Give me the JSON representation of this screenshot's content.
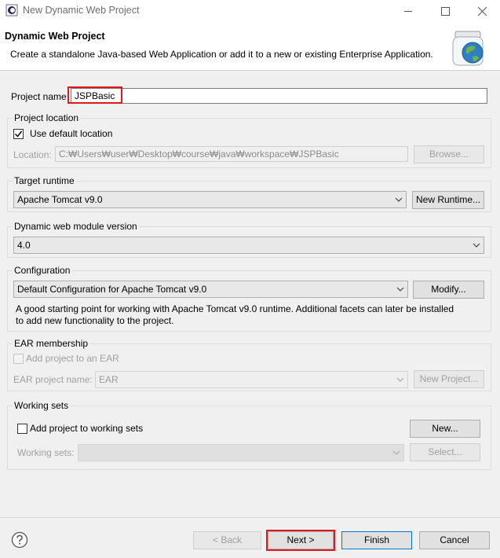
{
  "window": {
    "title": "New Dynamic Web Project"
  },
  "banner": {
    "title": "Dynamic Web Project",
    "description": "Create a standalone Java-based Web Application or add it to a new or existing Enterprise Application."
  },
  "project_name": {
    "label": "Project name:",
    "value": "JSPBasic"
  },
  "project_location": {
    "group_label": "Project location",
    "use_default_label": "Use default location",
    "use_default_checked": true,
    "location_label": "Location:",
    "location_value": "C:₩Users₩user₩Desktop₩course₩java₩workspace₩JSPBasic",
    "browse_label": "Browse..."
  },
  "target_runtime": {
    "group_label": "Target runtime",
    "selected": "Apache Tomcat v9.0",
    "new_runtime_label": "New Runtime..."
  },
  "module_version": {
    "group_label": "Dynamic web module version",
    "selected": "4.0"
  },
  "configuration": {
    "group_label": "Configuration",
    "selected": "Default Configuration for Apache Tomcat v9.0",
    "modify_label": "Modify...",
    "description_line1": "A good starting point for working with Apache Tomcat v9.0 runtime. Additional facets can later be installed",
    "description_line2": "to add new functionality to the project."
  },
  "ear_membership": {
    "group_label": "EAR membership",
    "add_label": "Add project to an EAR",
    "add_checked": false,
    "ear_name_label": "EAR project name:",
    "ear_name_value": "EAR",
    "new_project_label": "New Project..."
  },
  "working_sets": {
    "group_label": "Working sets",
    "add_label": "Add project to working sets",
    "add_checked": false,
    "new_label": "New...",
    "sets_label": "Working sets:",
    "sets_value": "",
    "select_label": "Select..."
  },
  "footer": {
    "help_icon": "help-icon",
    "back_label": "< Back",
    "next_label": "Next >",
    "finish_label": "Finish",
    "cancel_label": "Cancel"
  },
  "colors": {
    "highlight": "#e0181c",
    "primary_border": "#0078d7"
  }
}
